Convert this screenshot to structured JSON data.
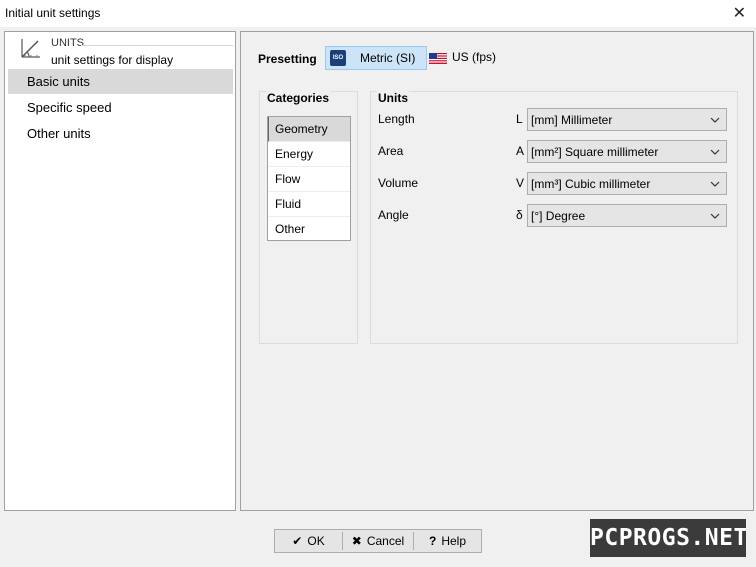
{
  "window": {
    "title": "Initial unit settings"
  },
  "nav": {
    "header": {
      "title": "UNITS",
      "subtitle": "unit settings for display"
    },
    "items": [
      {
        "label": "Basic units",
        "selected": true
      },
      {
        "label": "Specific speed",
        "selected": false
      },
      {
        "label": "Other units",
        "selected": false
      }
    ]
  },
  "presetting": {
    "label": "Presetting",
    "metric": {
      "badge": "ISO",
      "label": "Metric (SI)",
      "active": true
    },
    "us": {
      "label": "US (fps)",
      "active": false
    }
  },
  "categories": {
    "title": "Categories",
    "items": [
      {
        "label": "Geometry",
        "selected": true
      },
      {
        "label": "Energy",
        "selected": false
      },
      {
        "label": "Flow",
        "selected": false
      },
      {
        "label": "Fluid",
        "selected": false
      },
      {
        "label": "Other",
        "selected": false
      }
    ]
  },
  "units": {
    "title": "Units",
    "rows": [
      {
        "label": "Length",
        "symbol": "L",
        "value": "[mm] Millimeter"
      },
      {
        "label": "Area",
        "symbol": "A",
        "value": "[mm²] Square millimeter"
      },
      {
        "label": "Volume",
        "symbol": "V",
        "value": "[mm³] Cubic millimeter"
      },
      {
        "label": "Angle",
        "symbol": "δ",
        "value": "[°] Degree"
      }
    ]
  },
  "buttons": {
    "ok": {
      "icon": "checkmark-icon",
      "label": "OK"
    },
    "cancel": {
      "icon": "cross-icon",
      "label": "Cancel"
    },
    "help": {
      "icon": "question-icon",
      "label": "Help"
    }
  },
  "watermark": "PCPROGS.NET",
  "colors": {
    "selection": "#d9d9d9",
    "preset_active": "#cce4f7"
  }
}
